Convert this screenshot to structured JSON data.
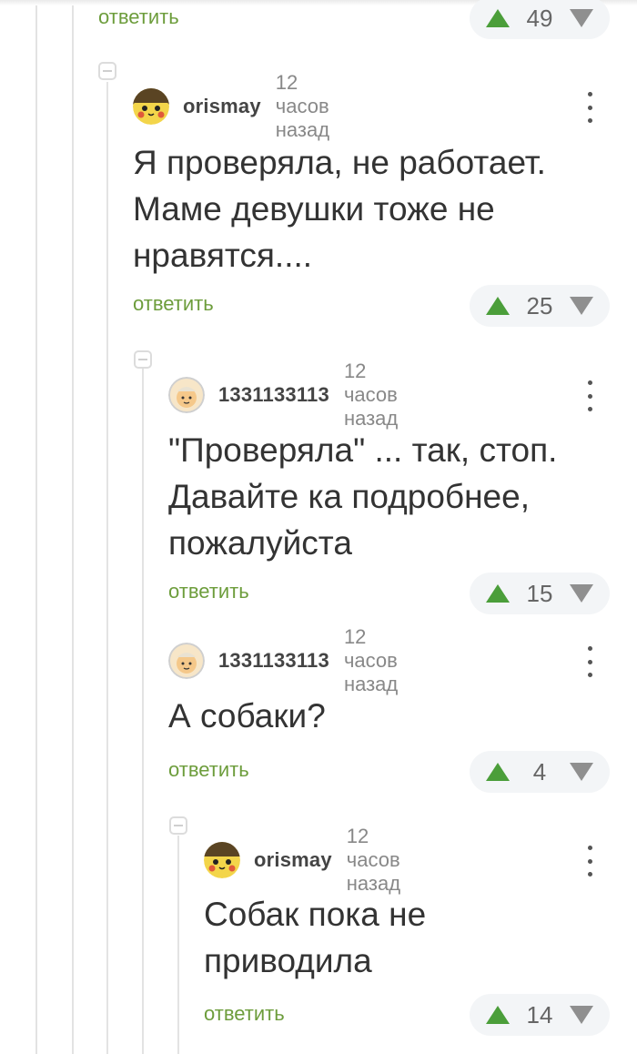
{
  "reply_label": "ответить",
  "top_item": {
    "reply": "ответить",
    "score": "49"
  },
  "comments": [
    {
      "author": "orismay",
      "time": "12 часов назад",
      "text": "Я проверяла, не работает. Маме девушки тоже не нравятся....",
      "reply": "ответить",
      "score": "25",
      "avatar_icon": "pikachu-avatar-icon"
    },
    {
      "author": "1331133113",
      "time": "12 часов назад",
      "text": "\"Проверяла\" ... так, стоп. Давайте ка подробнее, пожалуйста",
      "reply": "ответить",
      "score": "15",
      "avatar_icon": "baby-avatar-icon"
    },
    {
      "author": "1331133113",
      "time": "12 часов назад",
      "text": "А собаки?",
      "reply": "ответить",
      "score": "4",
      "avatar_icon": "baby-avatar-icon"
    },
    {
      "author": "orismay",
      "time": "12 часов назад",
      "text": "Собак пока не приводила",
      "reply": "ответить",
      "score": "14",
      "avatar_icon": "pikachu-avatar-icon"
    }
  ],
  "colors": {
    "accent_green": "#6d9d3c",
    "upvote": "#4b9e3a",
    "downvote": "#8f8f8f",
    "vote_bg": "#f3f5f7"
  }
}
